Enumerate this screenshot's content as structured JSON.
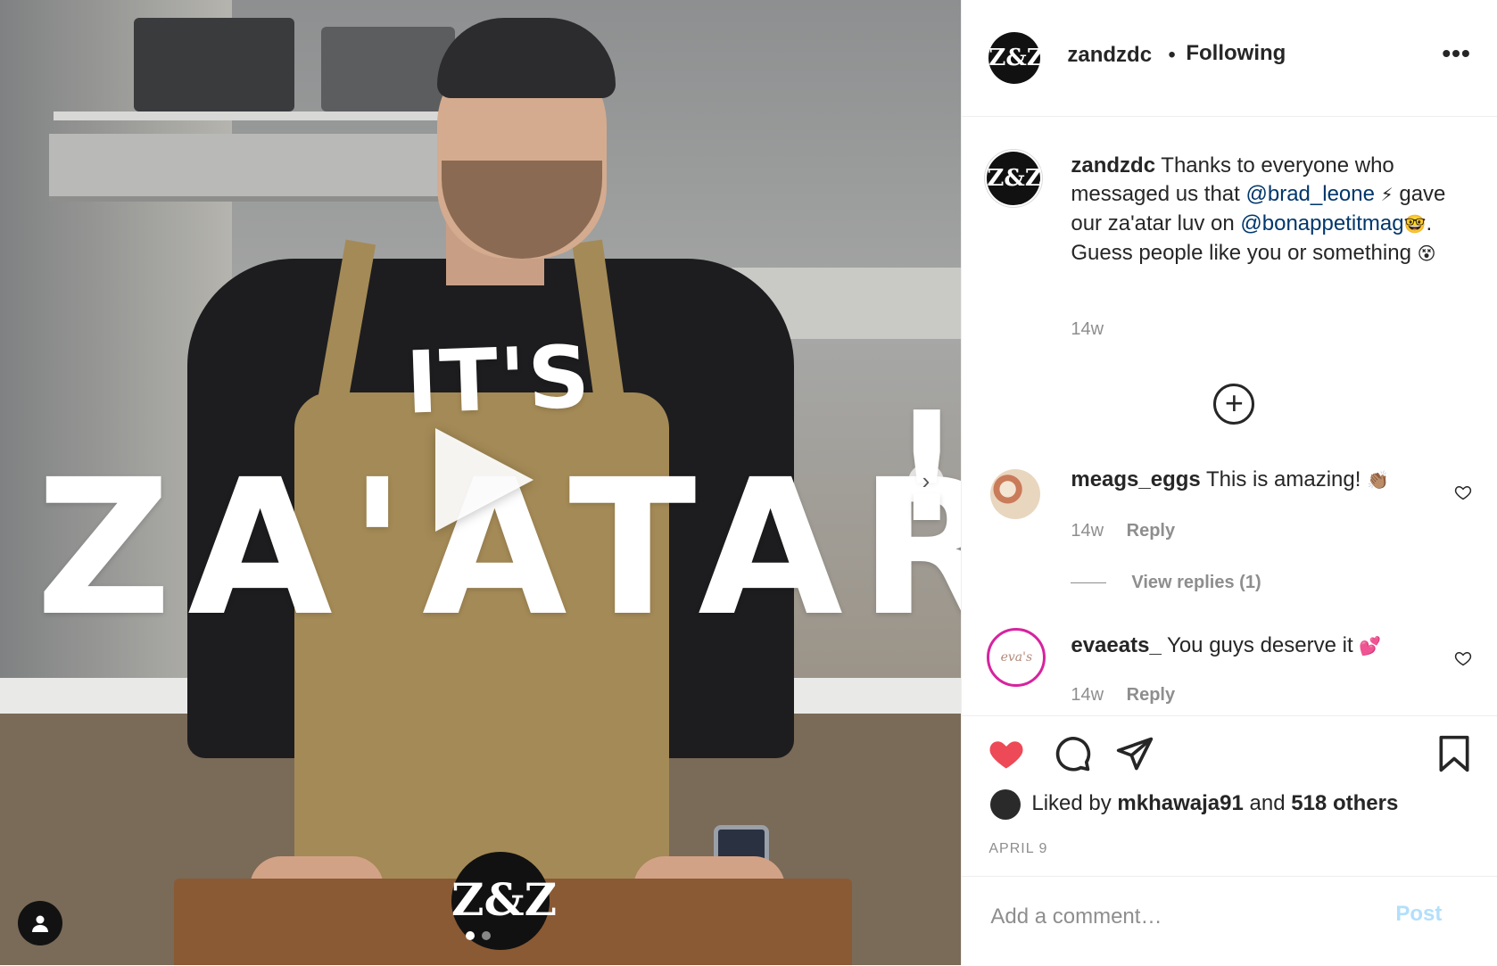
{
  "media": {
    "overlay_its": "IT'S",
    "overlay_zaatar": "ZA'ATAR",
    "overlay_bang": "!",
    "logo_text": "Z&Z",
    "next_arrow": "›",
    "carousel_dots": 2,
    "active_dot": 0
  },
  "header": {
    "avatar_text": "Z&Z",
    "username": "zandzdc",
    "separator": "•",
    "following": "Following",
    "more": "•••"
  },
  "caption": {
    "avatar_text": "Z&Z",
    "username": "zandzdc",
    "text_1": "Thanks to everyone who messaged us that",
    "mention_1": "@brad_leone",
    "emoji_1": "⚡",
    "text_2": "gave our za'atar luv on",
    "mention_2": "@bonappetitmag",
    "emoji_2": "🤓",
    "text_3": ". Guess people like you or something",
    "emoji_3": "😵",
    "time": "14w"
  },
  "comments": [
    {
      "username": "meags_eggs",
      "text": "This is amazing!",
      "emoji": "👏🏽",
      "time": "14w",
      "reply": "Reply"
    },
    {
      "username": "evaeats_",
      "text": "You guys deserve it",
      "emoji": "💕",
      "time": "14w",
      "reply": "Reply",
      "avatar_text": "eva's"
    }
  ],
  "view_replies": "View replies (1)",
  "likes": {
    "prefix": "Liked by",
    "user": "mkhawaja91",
    "and": "and",
    "others": "518 others"
  },
  "date": "APRIL 9",
  "add_comment": {
    "placeholder": "Add a comment…",
    "post": "Post"
  },
  "colors": {
    "like_red": "#ed4956",
    "mention_blue": "#00376b",
    "post_disabled": "#b2dffc"
  },
  "icons": [
    "heart-filled-icon",
    "comment-icon",
    "share-icon",
    "bookmark-icon",
    "plus-circle-icon",
    "user-tag-icon",
    "play-icon",
    "chevron-right-icon"
  ]
}
